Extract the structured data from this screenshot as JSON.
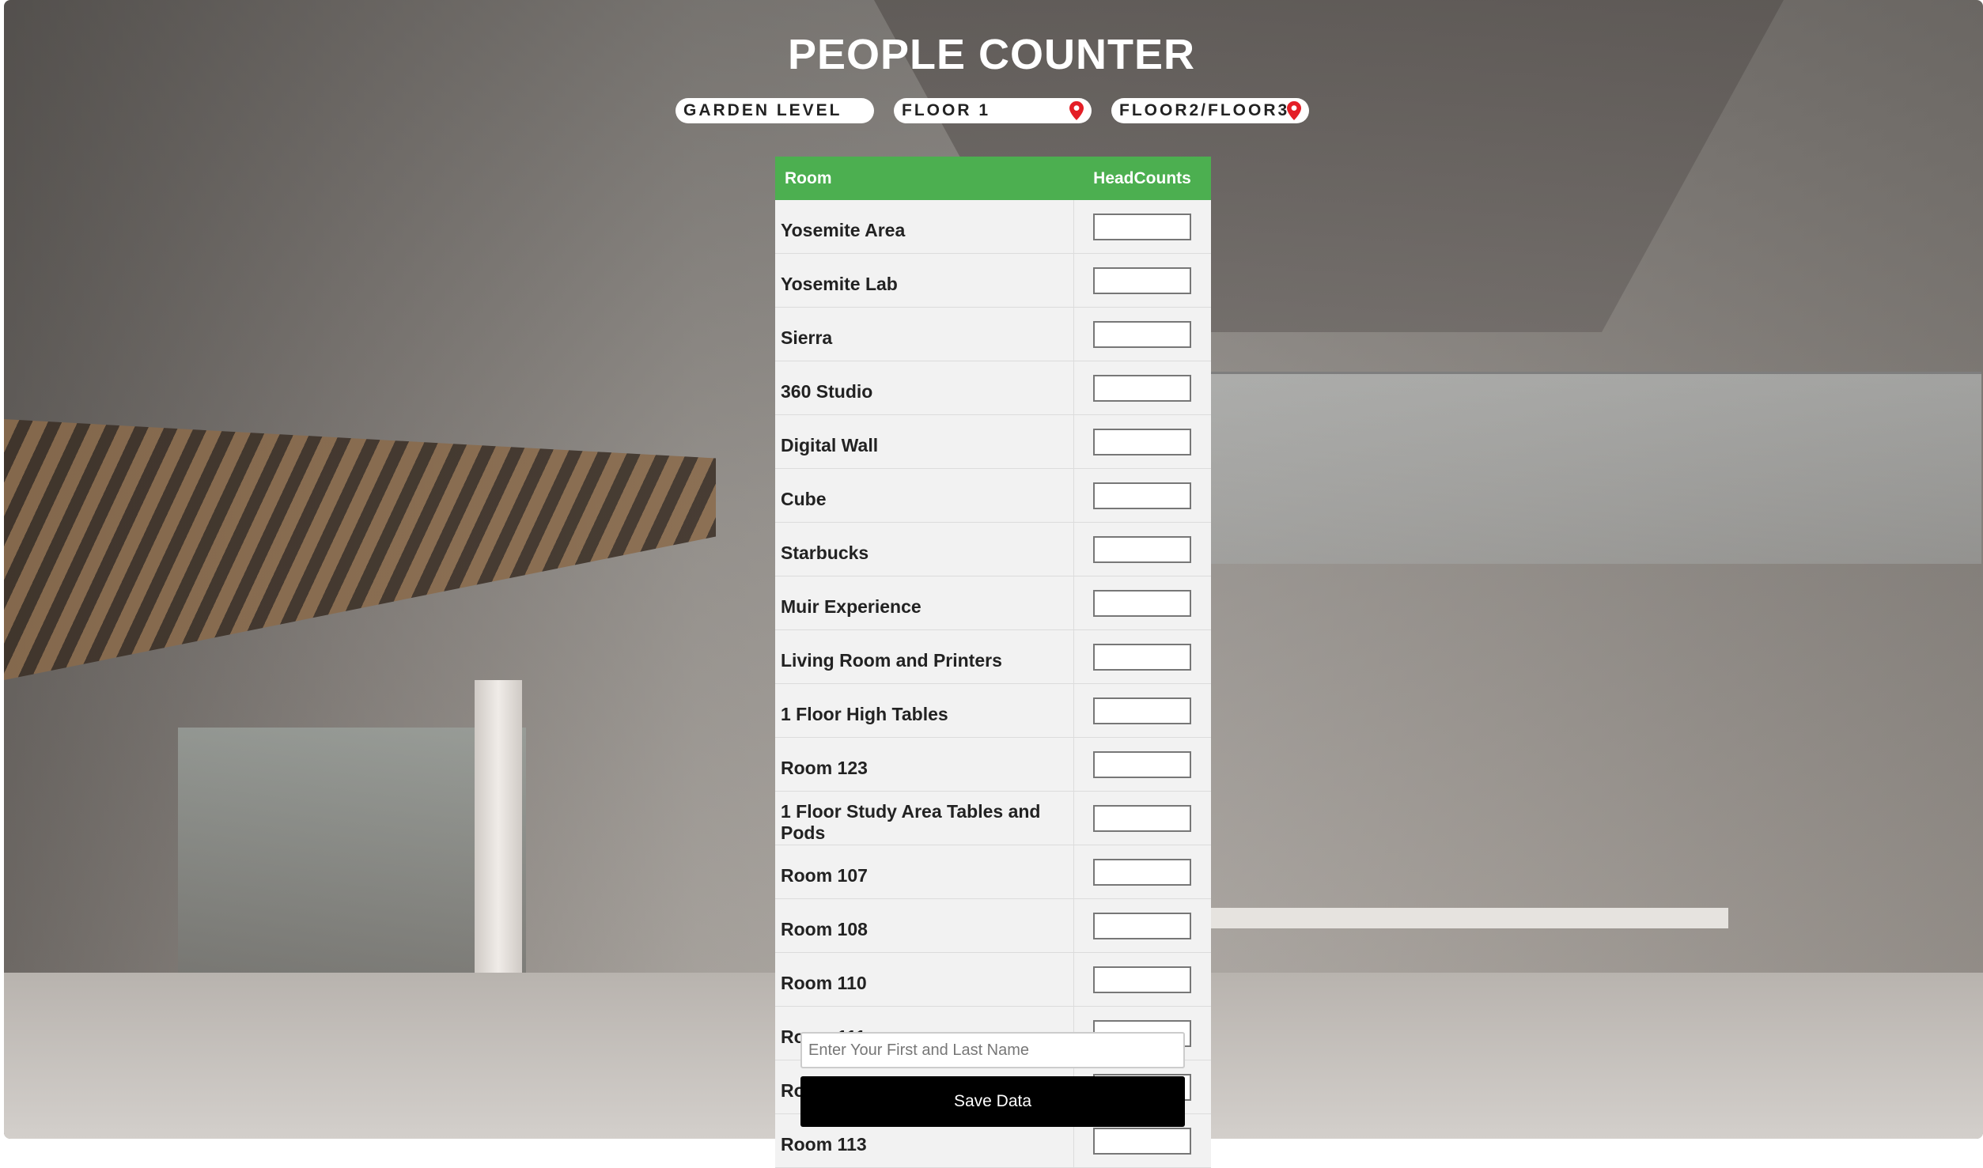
{
  "header": {
    "title": "PEOPLE COUNTER"
  },
  "floors": [
    {
      "label": "GARDEN LEVEL",
      "icon": ""
    },
    {
      "label": "FLOOR 1",
      "icon": "map-pin-icon"
    },
    {
      "label": "FLOOR2/FLOOR3",
      "icon": "map-pin-icon"
    }
  ],
  "colors": {
    "header_green": "#4caf50",
    "pin_red": "#e41e26",
    "save_black": "#000000"
  },
  "table": {
    "headers": {
      "room": "Room",
      "headcounts": "HeadCounts"
    },
    "rows": [
      "Yosemite Area",
      "Yosemite Lab",
      "Sierra",
      "360 Studio",
      "Digital Wall",
      "Cube",
      "Starbucks",
      "Muir Experience",
      "Living Room and Printers",
      "1 Floor High Tables",
      "Room 123",
      "1 Floor Study Area Tables and Pods",
      "Room 107",
      "Room 108",
      "Room 110",
      "Room 111",
      "Room 112",
      "Room 113"
    ]
  },
  "form": {
    "name_placeholder": "Enter Your First and Last Name",
    "name_value": "",
    "save_label": "Save Data"
  }
}
